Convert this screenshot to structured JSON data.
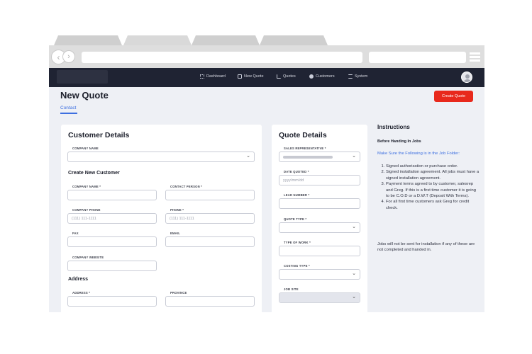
{
  "navbar": {
    "items": [
      {
        "label": "Dashboard",
        "icon": "grid-icon"
      },
      {
        "label": "New Quote",
        "icon": "plus-square-icon"
      },
      {
        "label": "Quotes",
        "icon": "bar-chart-icon"
      },
      {
        "label": "Customers",
        "icon": "users-icon"
      },
      {
        "label": "System",
        "icon": "sliders-icon"
      }
    ]
  },
  "page": {
    "title": "New Quote",
    "create_button": "Create Quote",
    "tab": "Contact"
  },
  "customer": {
    "title": "Customer Details",
    "company_name_label": "COMPANY NAME",
    "create_new_heading": "Create New Customer",
    "new_company_name_label": "COMPANY NAME *",
    "contact_person_label": "CONTACT PERSON *",
    "company_phone_label": "COMPANY PHONE",
    "company_phone_placeholder": "(111) 111-1111",
    "phone_label": "PHONE *",
    "phone_placeholder": "(111) 111-1111",
    "fax_label": "FAX",
    "email_label": "EMAIL",
    "website_label": "COMPANY WEBSITE",
    "address_heading": "Address",
    "address_label": "ADDRESS *",
    "province_label": "PROVINCE"
  },
  "quote": {
    "title": "Quote Details",
    "sales_rep_label": "SALES REPRESENTATIVE *",
    "date_quoted_label": "DATE QUOTED *",
    "date_quoted_placeholder": "yyyy/mm/dd",
    "lead_number_label": "LEAD NUMBER *",
    "quote_type_label": "QUOTE TYPE *",
    "type_of_work_label": "TYPE OF WORK *",
    "costing_type_label": "COSTING TYPE *",
    "job_site_label": "JOB SITE"
  },
  "instructions": {
    "title": "Instructions",
    "subtitle": "Before Handing In Jobs",
    "link": "Make Sure the Following is in the Job Folder:",
    "items": [
      "Signed authorization or purchase order.",
      "Signed installation agreement. All jobs must have a signed installation agreement.",
      "Payment terms agreed to by customer, salesrep and Greg. If this is a first time customer it is going to be C.O.D or a D.W.T (Deposit With Terms).",
      "For all first time customers ask Greg for credit check."
    ],
    "note": "Jobs will not be sent for installation if any of these are not completed and handed in."
  },
  "colors": {
    "navbar": "#1f2333",
    "accent": "#3d6fe0",
    "primary_button": "#e8291c",
    "background": "#eef0f5"
  }
}
